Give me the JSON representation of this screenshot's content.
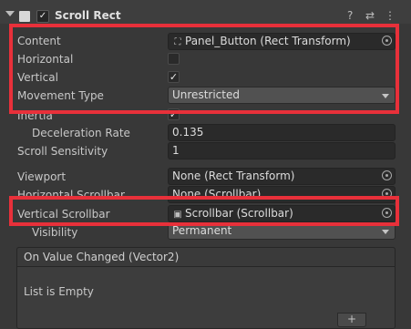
{
  "header": {
    "title": "Scroll Rect",
    "enabled_glyph": "✓",
    "help_glyph": "?",
    "settings_glyph": "⇄",
    "menu_glyph": "⋮"
  },
  "rows": {
    "content": {
      "label": "Content",
      "value": "Panel_Button (Rect Transform)",
      "icon": "rect-transform-icon"
    },
    "horizontal": {
      "label": "Horizontal",
      "checked": false
    },
    "vertical": {
      "label": "Vertical",
      "checked": true,
      "glyph": "✓"
    },
    "movement_type": {
      "label": "Movement Type",
      "value": "Unrestricted"
    },
    "inertia": {
      "label": "Inertia",
      "glyph": "✓"
    },
    "deceleration_rate": {
      "label": "Deceleration Rate",
      "value": "0.135"
    },
    "scroll_sensitivity": {
      "label": "Scroll Sensitivity",
      "value": "1"
    },
    "viewport": {
      "label": "Viewport",
      "value": "None (Rect Transform)"
    },
    "horizontal_scrollbar": {
      "label": "Horizontal Scrollbar",
      "value": "None (Scrollbar)"
    },
    "vertical_scrollbar": {
      "label": "Vertical Scrollbar",
      "value": "Scrollbar (Scrollbar)",
      "icon": "script-icon"
    },
    "visibility": {
      "label": "Visibility",
      "value": "Permanent"
    }
  },
  "event": {
    "title": "On Value Changed (Vector2)",
    "empty_text": "List is Empty",
    "add_glyph": "+"
  },
  "colors": {
    "highlight": "#e8303a",
    "background": "#383838",
    "field": "#2a2a2a"
  }
}
